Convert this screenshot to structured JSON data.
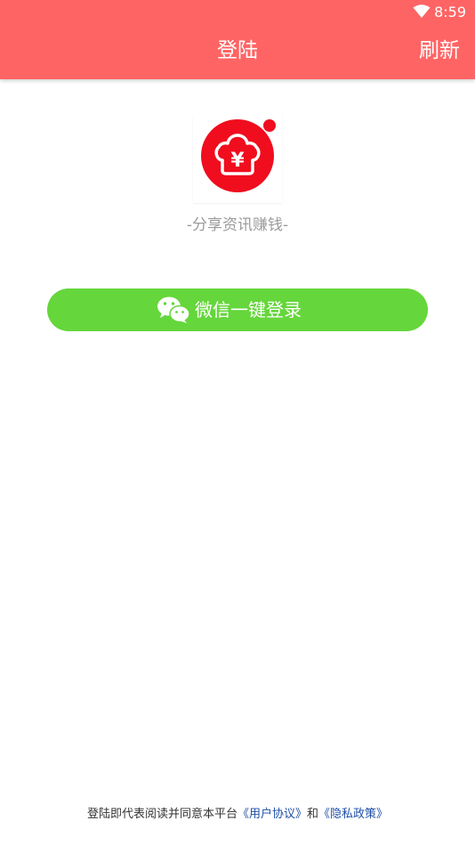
{
  "status_bar": {
    "time": "8:59",
    "icons": [
      "wifi-icon"
    ]
  },
  "header": {
    "title": "登陆",
    "refresh_label": "刷新"
  },
  "logo": {
    "symbol": "¥",
    "icon": "logo-icon"
  },
  "slogan": "-分享资讯赚钱-",
  "wechat_login": {
    "label": "微信一键登录",
    "icon": "wechat-icon"
  },
  "footer": {
    "prefix": "登陆即代表阅读并同意本平台",
    "user_agreement": "《用户协议》",
    "conjunction": "和",
    "privacy_policy": "《隐私政策》"
  },
  "colors": {
    "header_bg": "#ff6464",
    "button_bg": "#65d63b",
    "logo_red": "#f00d1e",
    "link": "#1e4fa8"
  }
}
